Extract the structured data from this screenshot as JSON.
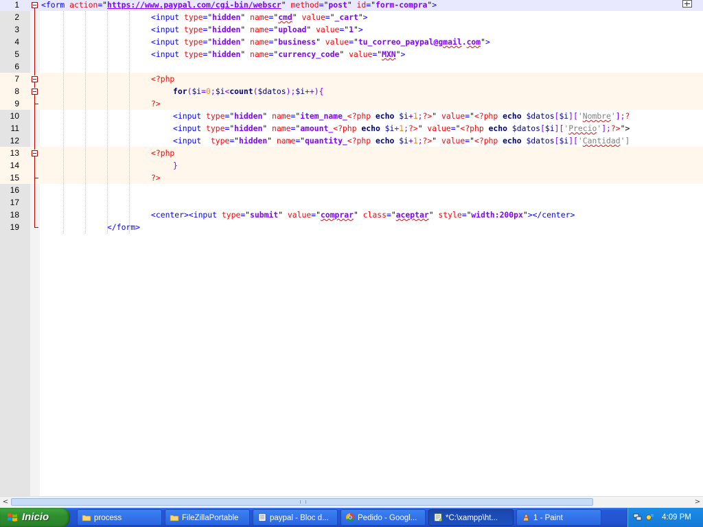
{
  "editor": {
    "lines": [
      {
        "n": "1",
        "indent": 0,
        "active": true,
        "tokens": [
          {
            "t": "<form ",
            "c": "tag"
          },
          {
            "t": "action",
            "c": "attr"
          },
          {
            "t": "=",
            "c": "tag"
          },
          {
            "t": "\"",
            "c": "plain"
          },
          {
            "t": "https://www.paypal.com/cgi-bin/webscr",
            "c": "str",
            "link": true
          },
          {
            "t": "\"",
            "c": "plain"
          },
          {
            "t": " method",
            "c": "attr"
          },
          {
            "t": "=",
            "c": "tag"
          },
          {
            "t": "\"",
            "c": "plain"
          },
          {
            "t": "post",
            "c": "str"
          },
          {
            "t": "\"",
            "c": "plain"
          },
          {
            "t": " id",
            "c": "attr"
          },
          {
            "t": "=",
            "c": "tag"
          },
          {
            "t": "\"",
            "c": "plain"
          },
          {
            "t": "form-compra",
            "c": "str"
          },
          {
            "t": "\"",
            "c": "plain"
          },
          {
            "t": ">",
            "c": "tag"
          }
        ]
      },
      {
        "n": "2",
        "indent": 5,
        "tokens": [
          {
            "t": "<input ",
            "c": "tag"
          },
          {
            "t": "type",
            "c": "attr"
          },
          {
            "t": "=",
            "c": "tag"
          },
          {
            "t": "\"",
            "c": "plain"
          },
          {
            "t": "hidden",
            "c": "str"
          },
          {
            "t": "\"",
            "c": "plain"
          },
          {
            "t": " name",
            "c": "attr"
          },
          {
            "t": "=",
            "c": "tag"
          },
          {
            "t": "\"",
            "c": "plain"
          },
          {
            "t": "cmd",
            "c": "str",
            "spell": true
          },
          {
            "t": "\"",
            "c": "plain"
          },
          {
            "t": " value",
            "c": "attr"
          },
          {
            "t": "=",
            "c": "tag"
          },
          {
            "t": "\"",
            "c": "plain"
          },
          {
            "t": "_cart",
            "c": "str"
          },
          {
            "t": "\"",
            "c": "plain"
          },
          {
            "t": ">",
            "c": "tag"
          }
        ]
      },
      {
        "n": "3",
        "indent": 5,
        "tokens": [
          {
            "t": "<input ",
            "c": "tag"
          },
          {
            "t": "type",
            "c": "attr"
          },
          {
            "t": "=",
            "c": "tag"
          },
          {
            "t": "\"",
            "c": "plain"
          },
          {
            "t": "hidden",
            "c": "str"
          },
          {
            "t": "\"",
            "c": "plain"
          },
          {
            "t": " name",
            "c": "attr"
          },
          {
            "t": "=",
            "c": "tag"
          },
          {
            "t": "\"",
            "c": "plain"
          },
          {
            "t": "upload",
            "c": "str"
          },
          {
            "t": "\"",
            "c": "plain"
          },
          {
            "t": " value",
            "c": "attr"
          },
          {
            "t": "=",
            "c": "tag"
          },
          {
            "t": "\"",
            "c": "plain"
          },
          {
            "t": "1",
            "c": "str"
          },
          {
            "t": "\"",
            "c": "plain"
          },
          {
            "t": ">",
            "c": "tag"
          }
        ]
      },
      {
        "n": "4",
        "indent": 5,
        "tokens": [
          {
            "t": "<input ",
            "c": "tag"
          },
          {
            "t": "type",
            "c": "attr"
          },
          {
            "t": "=",
            "c": "tag"
          },
          {
            "t": "\"",
            "c": "plain"
          },
          {
            "t": "hidden",
            "c": "str"
          },
          {
            "t": "\"",
            "c": "plain"
          },
          {
            "t": " name",
            "c": "attr"
          },
          {
            "t": "=",
            "c": "tag"
          },
          {
            "t": "\"",
            "c": "plain"
          },
          {
            "t": "business",
            "c": "str"
          },
          {
            "t": "\"",
            "c": "plain"
          },
          {
            "t": " value",
            "c": "attr"
          },
          {
            "t": "=",
            "c": "tag"
          },
          {
            "t": "\"",
            "c": "plain"
          },
          {
            "t": "tu_correo_paypal@",
            "c": "str"
          },
          {
            "t": "gmail",
            "c": "str",
            "spell": true
          },
          {
            "t": ".",
            "c": "str"
          },
          {
            "t": "com",
            "c": "str",
            "spell": true
          },
          {
            "t": "\"",
            "c": "plain"
          },
          {
            "t": ">",
            "c": "tag"
          }
        ]
      },
      {
        "n": "5",
        "indent": 5,
        "tokens": [
          {
            "t": "<input ",
            "c": "tag"
          },
          {
            "t": "type",
            "c": "attr"
          },
          {
            "t": "=",
            "c": "tag"
          },
          {
            "t": "\"",
            "c": "plain"
          },
          {
            "t": "hidden",
            "c": "str"
          },
          {
            "t": "\"",
            "c": "plain"
          },
          {
            "t": " name",
            "c": "attr"
          },
          {
            "t": "=",
            "c": "tag"
          },
          {
            "t": "\"",
            "c": "plain"
          },
          {
            "t": "currency_code",
            "c": "str"
          },
          {
            "t": "\"",
            "c": "plain"
          },
          {
            "t": " value",
            "c": "attr"
          },
          {
            "t": "=",
            "c": "tag"
          },
          {
            "t": "\"",
            "c": "plain"
          },
          {
            "t": "MXN",
            "c": "str",
            "spell": true
          },
          {
            "t": "\"",
            "c": "plain"
          },
          {
            "t": ">",
            "c": "tag"
          }
        ]
      },
      {
        "n": "6",
        "indent": 0,
        "tokens": []
      },
      {
        "n": "7",
        "indent": 5,
        "hl": true,
        "tokens": [
          {
            "t": "<?php",
            "c": "php"
          }
        ]
      },
      {
        "n": "8",
        "indent": 6,
        "hl": true,
        "tokens": [
          {
            "t": "for",
            "c": "kw"
          },
          {
            "t": "(",
            "c": "ops"
          },
          {
            "t": "$i",
            "c": "var"
          },
          {
            "t": "=",
            "c": "ops"
          },
          {
            "t": "0",
            "c": "num"
          },
          {
            "t": ";",
            "c": "ops"
          },
          {
            "t": "$i",
            "c": "var"
          },
          {
            "t": "<",
            "c": "ops"
          },
          {
            "t": "count",
            "c": "kw"
          },
          {
            "t": "(",
            "c": "ops"
          },
          {
            "t": "$datos",
            "c": "var"
          },
          {
            "t": ");",
            "c": "ops"
          },
          {
            "t": "$i",
            "c": "var"
          },
          {
            "t": "++){",
            "c": "ops"
          }
        ]
      },
      {
        "n": "9",
        "indent": 5,
        "hl": true,
        "tokens": [
          {
            "t": "?>",
            "c": "php"
          }
        ]
      },
      {
        "n": "10",
        "indent": 6,
        "tokens": [
          {
            "t": "<input ",
            "c": "tag"
          },
          {
            "t": "type",
            "c": "attr"
          },
          {
            "t": "=",
            "c": "tag"
          },
          {
            "t": "\"",
            "c": "plain"
          },
          {
            "t": "hidden",
            "c": "str"
          },
          {
            "t": "\"",
            "c": "plain"
          },
          {
            "t": " name",
            "c": "attr"
          },
          {
            "t": "=",
            "c": "tag"
          },
          {
            "t": "\"",
            "c": "plain"
          },
          {
            "t": "item_name_",
            "c": "str"
          },
          {
            "t": "<?php",
            "c": "php"
          },
          {
            "t": " echo ",
            "c": "kw"
          },
          {
            "t": "$i",
            "c": "var"
          },
          {
            "t": "+",
            "c": "ops"
          },
          {
            "t": "1",
            "c": "num"
          },
          {
            "t": ";",
            "c": "ops"
          },
          {
            "t": "?>",
            "c": "php"
          },
          {
            "t": "\"",
            "c": "plain"
          },
          {
            "t": " value",
            "c": "attr"
          },
          {
            "t": "=",
            "c": "tag"
          },
          {
            "t": "\"",
            "c": "plain"
          },
          {
            "t": "<?php",
            "c": "php"
          },
          {
            "t": " echo ",
            "c": "kw"
          },
          {
            "t": "$datos",
            "c": "var"
          },
          {
            "t": "[",
            "c": "ops"
          },
          {
            "t": "$i",
            "c": "var"
          },
          {
            "t": "][",
            "c": "ops"
          },
          {
            "t": "'",
            "c": "sq"
          },
          {
            "t": "Nombre",
            "c": "sq",
            "spell": true
          },
          {
            "t": "'",
            "c": "sq"
          },
          {
            "t": "];",
            "c": "ops"
          },
          {
            "t": "?",
            "c": "php"
          }
        ]
      },
      {
        "n": "11",
        "indent": 6,
        "tokens": [
          {
            "t": "<input ",
            "c": "tag"
          },
          {
            "t": "type",
            "c": "attr"
          },
          {
            "t": "=",
            "c": "tag"
          },
          {
            "t": "\"",
            "c": "plain"
          },
          {
            "t": "hidden",
            "c": "str"
          },
          {
            "t": "\"",
            "c": "plain"
          },
          {
            "t": " name",
            "c": "attr"
          },
          {
            "t": "=",
            "c": "tag"
          },
          {
            "t": "\"",
            "c": "plain"
          },
          {
            "t": "amount_",
            "c": "str"
          },
          {
            "t": "<?php",
            "c": "php"
          },
          {
            "t": " echo ",
            "c": "kw"
          },
          {
            "t": "$i",
            "c": "var"
          },
          {
            "t": "+",
            "c": "ops"
          },
          {
            "t": "1",
            "c": "num"
          },
          {
            "t": ";",
            "c": "ops"
          },
          {
            "t": "?>",
            "c": "php"
          },
          {
            "t": "\"",
            "c": "plain"
          },
          {
            "t": " value",
            "c": "attr"
          },
          {
            "t": "=",
            "c": "tag"
          },
          {
            "t": "\"",
            "c": "plain"
          },
          {
            "t": "<?php",
            "c": "php"
          },
          {
            "t": " echo ",
            "c": "kw"
          },
          {
            "t": "$datos",
            "c": "var"
          },
          {
            "t": "[",
            "c": "ops"
          },
          {
            "t": "$i",
            "c": "var"
          },
          {
            "t": "][",
            "c": "ops"
          },
          {
            "t": "'",
            "c": "sq"
          },
          {
            "t": "Precio",
            "c": "sq",
            "spell": true
          },
          {
            "t": "'",
            "c": "sq"
          },
          {
            "t": "];",
            "c": "ops"
          },
          {
            "t": "?>",
            "c": "php"
          },
          {
            "t": "\">",
            "c": "plain"
          }
        ]
      },
      {
        "n": "12",
        "indent": 6,
        "tokens": [
          {
            "t": "<input  ",
            "c": "tag"
          },
          {
            "t": "type",
            "c": "attr"
          },
          {
            "t": "=",
            "c": "tag"
          },
          {
            "t": "\"",
            "c": "plain"
          },
          {
            "t": "hidden",
            "c": "str"
          },
          {
            "t": "\"",
            "c": "plain"
          },
          {
            "t": " name",
            "c": "attr"
          },
          {
            "t": "=",
            "c": "tag"
          },
          {
            "t": "\"",
            "c": "plain"
          },
          {
            "t": "quantity_",
            "c": "str"
          },
          {
            "t": "<?php",
            "c": "php"
          },
          {
            "t": " echo ",
            "c": "kw"
          },
          {
            "t": "$i",
            "c": "var"
          },
          {
            "t": "+",
            "c": "ops"
          },
          {
            "t": "1",
            "c": "num"
          },
          {
            "t": ";",
            "c": "ops"
          },
          {
            "t": "?>",
            "c": "php"
          },
          {
            "t": "\"",
            "c": "plain"
          },
          {
            "t": " value",
            "c": "attr"
          },
          {
            "t": "=",
            "c": "tag"
          },
          {
            "t": "\"",
            "c": "plain"
          },
          {
            "t": "<?php",
            "c": "php"
          },
          {
            "t": " echo ",
            "c": "kw"
          },
          {
            "t": "$datos",
            "c": "var"
          },
          {
            "t": "[",
            "c": "ops"
          },
          {
            "t": "$i",
            "c": "var"
          },
          {
            "t": "][",
            "c": "ops"
          },
          {
            "t": "'",
            "c": "sq"
          },
          {
            "t": "Cantidad",
            "c": "sq",
            "spell": true
          },
          {
            "t": "']",
            "c": "sq"
          }
        ]
      },
      {
        "n": "13",
        "indent": 5,
        "hl": true,
        "tokens": [
          {
            "t": "<?php",
            "c": "php"
          }
        ]
      },
      {
        "n": "14",
        "indent": 6,
        "hl": true,
        "tokens": [
          {
            "t": "}",
            "c": "ops"
          }
        ]
      },
      {
        "n": "15",
        "indent": 5,
        "hl": true,
        "tokens": [
          {
            "t": "?>",
            "c": "php"
          }
        ]
      },
      {
        "n": "16",
        "indent": 0,
        "tokens": []
      },
      {
        "n": "17",
        "indent": 0,
        "tokens": []
      },
      {
        "n": "18",
        "indent": 5,
        "tokens": [
          {
            "t": "<center><input ",
            "c": "tag"
          },
          {
            "t": "type",
            "c": "attr"
          },
          {
            "t": "=",
            "c": "tag"
          },
          {
            "t": "\"",
            "c": "plain"
          },
          {
            "t": "submit",
            "c": "str"
          },
          {
            "t": "\"",
            "c": "plain"
          },
          {
            "t": " value",
            "c": "attr"
          },
          {
            "t": "=",
            "c": "tag"
          },
          {
            "t": "\"",
            "c": "plain"
          },
          {
            "t": "comprar",
            "c": "str",
            "spell": true
          },
          {
            "t": "\"",
            "c": "plain"
          },
          {
            "t": " class",
            "c": "attr"
          },
          {
            "t": "=",
            "c": "tag"
          },
          {
            "t": "\"",
            "c": "plain"
          },
          {
            "t": "aceptar",
            "c": "str",
            "spell": true
          },
          {
            "t": "\"",
            "c": "plain"
          },
          {
            "t": " style",
            "c": "attr"
          },
          {
            "t": "=",
            "c": "tag"
          },
          {
            "t": "\"",
            "c": "plain"
          },
          {
            "t": "width:200px",
            "c": "str"
          },
          {
            "t": "\"",
            "c": "plain"
          },
          {
            "t": "></center>",
            "c": "tag"
          }
        ]
      },
      {
        "n": "19",
        "indent": 3,
        "tokens": [
          {
            "t": "</form>",
            "c": "tag"
          }
        ]
      }
    ]
  },
  "scrollbar": {
    "left_arrow": "<",
    "right_arrow": ">"
  },
  "taskbar": {
    "start_label": "Inicio",
    "tasks": [
      {
        "label": "process",
        "icon": "folder-icon",
        "active": false
      },
      {
        "label": "FileZillaPortable",
        "icon": "folder-icon",
        "active": false
      },
      {
        "label": "paypal - Bloc d...",
        "icon": "notepad-icon",
        "active": false
      },
      {
        "label": "Pedido - Googl...",
        "icon": "chrome-icon",
        "active": false
      },
      {
        "label": "*C:\\xampp\\ht...",
        "icon": "notepadpp-icon",
        "active": true
      },
      {
        "label": "1 - Paint",
        "icon": "paint-icon",
        "active": false
      }
    ],
    "clock": "4:09 PM"
  },
  "colors": {
    "tag": "#0000ff",
    "attr": "#ff0000",
    "str": "#8000ff",
    "php": "#ff0000",
    "kw": "#000080",
    "num": "#ff8000",
    "fold": "#c00000",
    "taskbar": "#2352d0",
    "start": "#2f8f2f"
  }
}
